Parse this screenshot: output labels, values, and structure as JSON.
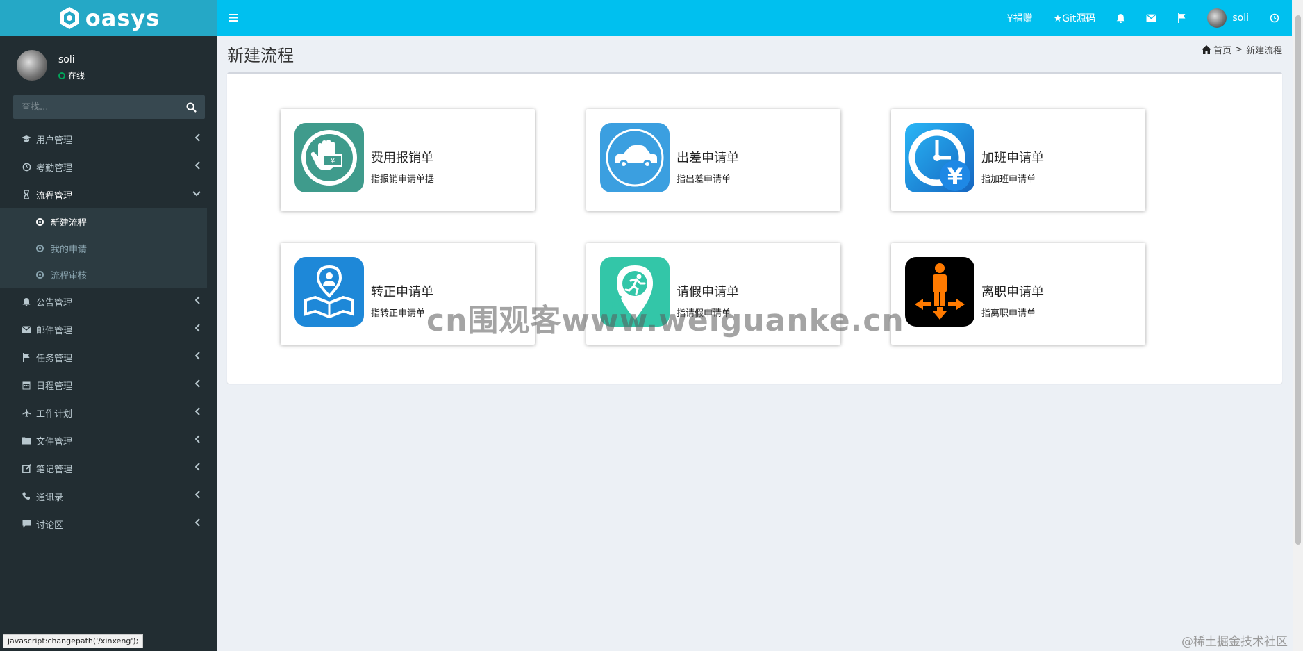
{
  "brand": {
    "name": "oasys"
  },
  "user": {
    "name": "soli",
    "status": "在线"
  },
  "search": {
    "placeholder": "查找..."
  },
  "sidebar": {
    "items": [
      {
        "label": "用户管理",
        "icon": "graduation-cap-icon"
      },
      {
        "label": "考勤管理",
        "icon": "clock-icon"
      },
      {
        "label": "流程管理",
        "icon": "hourglass-icon"
      },
      {
        "label": "公告管理",
        "icon": "bell-icon"
      },
      {
        "label": "邮件管理",
        "icon": "envelope-icon"
      },
      {
        "label": "任务管理",
        "icon": "flag-icon"
      },
      {
        "label": "日程管理",
        "icon": "calendar-icon"
      },
      {
        "label": "工作计划",
        "icon": "plane-icon"
      },
      {
        "label": "文件管理",
        "icon": "folder-icon"
      },
      {
        "label": "笔记管理",
        "icon": "edit-icon"
      },
      {
        "label": "通讯录",
        "icon": "phone-icon"
      },
      {
        "label": "讨论区",
        "icon": "comment-icon"
      }
    ],
    "submenu": [
      {
        "label": "新建流程",
        "active": true
      },
      {
        "label": "我的申请",
        "active": false
      },
      {
        "label": "流程审核",
        "active": false
      }
    ]
  },
  "topbar": {
    "donate": "¥捐赠",
    "git": "★Git源码",
    "username": "soli"
  },
  "page": {
    "title": "新建流程",
    "breadcrumb_home": "首页",
    "breadcrumb_sep": ">",
    "breadcrumb_current": "新建流程"
  },
  "cards": [
    {
      "title": "费用报销单",
      "desc": "指报销申请单据",
      "icon": "reimbursement-icon",
      "color": "#3f9b8c"
    },
    {
      "title": "出差申请单",
      "desc": "指出差申请单",
      "icon": "car-icon",
      "color": "#3b9fe0"
    },
    {
      "title": "加班申请单",
      "desc": "指加班申请单",
      "icon": "clock-yen-icon",
      "color": "#1e88e5"
    },
    {
      "title": "转正申请单",
      "desc": "指转正申请单",
      "icon": "person-map-icon",
      "color": "#1e88d8"
    },
    {
      "title": "请假申请单",
      "desc": "指请假申请单",
      "icon": "running-pin-icon",
      "color": "#33c6a8"
    },
    {
      "title": "离职申请单",
      "desc": "指离职申请单",
      "icon": "exit-arrows-icon",
      "color": "#ff7a00"
    }
  ],
  "statusbar": {
    "text": "javascript:changepath('/xinxeng');"
  },
  "watermark": {
    "text": "cn围观客www.weiguanke.cn"
  },
  "corner_mark": {
    "text": "@稀土掘金技术社区"
  },
  "colors": {
    "topbar": "#00c0ef",
    "logo_bg": "#25a8c6",
    "sidebar_bg": "#222d32",
    "content_bg": "#ecf0f5"
  }
}
